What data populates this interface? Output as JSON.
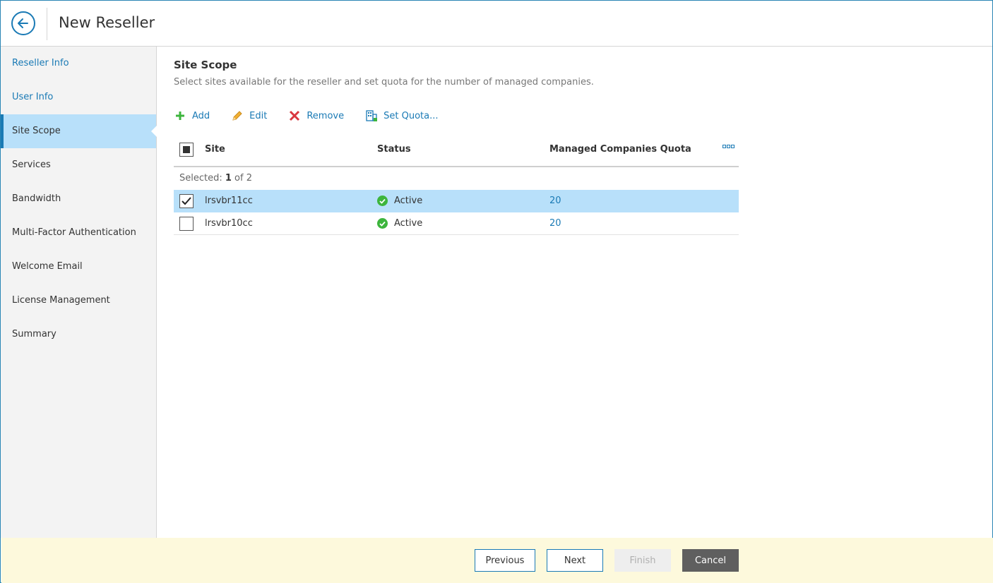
{
  "header": {
    "title": "New Reseller",
    "back_icon": "arrow-left-circle-icon"
  },
  "sidebar": {
    "items": [
      {
        "label": "Reseller Info",
        "state": "done"
      },
      {
        "label": "User Info",
        "state": "done"
      },
      {
        "label": "Site Scope",
        "state": "active"
      },
      {
        "label": "Services",
        "state": "pending"
      },
      {
        "label": "Bandwidth",
        "state": "pending"
      },
      {
        "label": "Multi-Factor Authentication",
        "state": "pending"
      },
      {
        "label": "Welcome Email",
        "state": "pending"
      },
      {
        "label": "License Management",
        "state": "pending"
      },
      {
        "label": "Summary",
        "state": "pending"
      }
    ]
  },
  "main": {
    "title": "Site Scope",
    "description": "Select sites available for the reseller and set quota for the number of managed companies.",
    "toolbar": {
      "add": "Add",
      "edit": "Edit",
      "remove": "Remove",
      "set_quota": "Set Quota..."
    },
    "grid": {
      "columns": {
        "site": "Site",
        "status": "Status",
        "quota": "Managed Companies Quota"
      },
      "selected_prefix": "Selected: ",
      "selected_count": "1",
      "selected_suffix": " of 2",
      "rows": [
        {
          "site": "lrsvbr11cc",
          "status": "Active",
          "quota": "20",
          "selected": true
        },
        {
          "site": "lrsvbr10cc",
          "status": "Active",
          "quota": "20",
          "selected": false
        }
      ]
    }
  },
  "footer": {
    "previous": "Previous",
    "next": "Next",
    "finish": "Finish",
    "cancel": "Cancel"
  },
  "colors": {
    "accent": "#1a7ab5",
    "selected_row": "#b8e0fa",
    "status_ok": "#3db53d",
    "footer_bg": "#fdf9dc",
    "remove_red": "#d9363e",
    "add_green": "#3db53d"
  }
}
